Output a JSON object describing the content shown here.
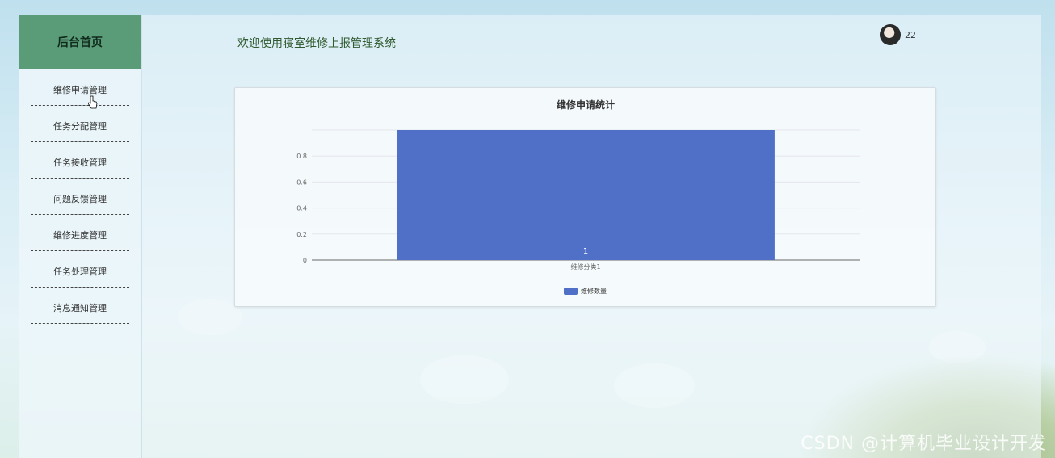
{
  "sidebar": {
    "title": "后台首页",
    "items": [
      {
        "label": "维修申请管理"
      },
      {
        "label": "任务分配管理"
      },
      {
        "label": "任务接收管理"
      },
      {
        "label": "问题反馈管理"
      },
      {
        "label": "维修进度管理"
      },
      {
        "label": "任务处理管理"
      },
      {
        "label": "消息通知管理"
      }
    ]
  },
  "header": {
    "welcome": "欢迎使用寝室维修上报管理系统",
    "user_label": "22"
  },
  "colors": {
    "sidebar_header": "#5a9c78",
    "bar": "#5070c8"
  },
  "chart_data": {
    "type": "bar",
    "title": "维修申请统计",
    "categories": [
      "维修分类1"
    ],
    "series": [
      {
        "name": "维修数量",
        "values": [
          1
        ]
      }
    ],
    "ylim": [
      0,
      1
    ],
    "yticks": [
      "0",
      "0.2",
      "0.4",
      "0.6",
      "0.8",
      "1"
    ],
    "data_labels": [
      "1"
    ],
    "grid": true,
    "legend": "bottom"
  },
  "watermark": "CSDN @计算机毕业设计开发"
}
